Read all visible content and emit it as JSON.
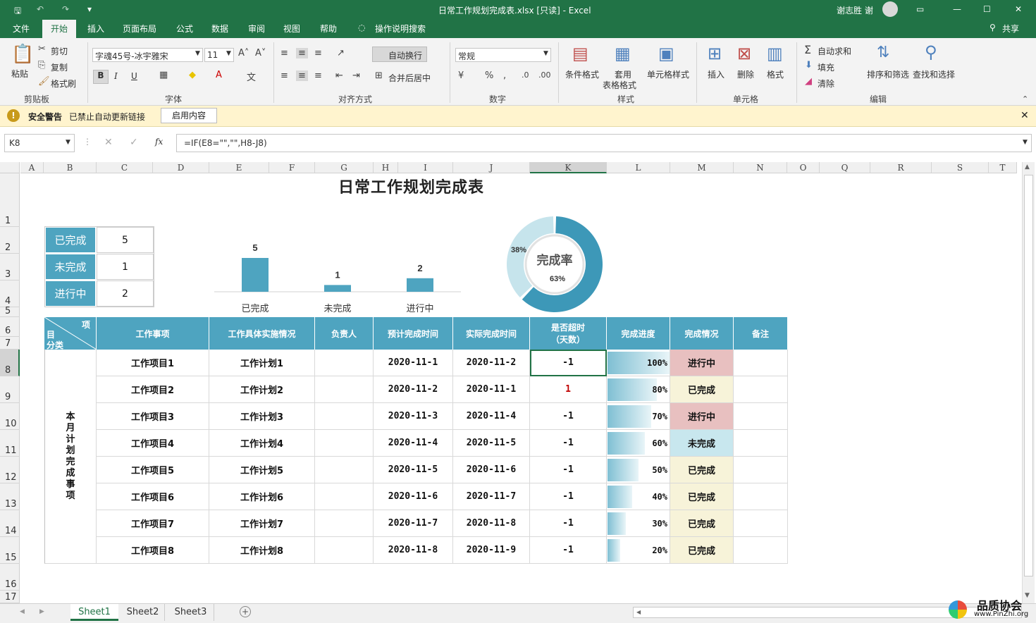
{
  "window": {
    "title": "日常工作规划完成表.xlsx  [只读]  -  Excel",
    "user": "谢志胜 谢"
  },
  "menu": [
    "文件",
    "开始",
    "插入",
    "页面布局",
    "公式",
    "数据",
    "审阅",
    "视图",
    "帮助",
    "操作说明搜索"
  ],
  "share": "共享",
  "ribbon": {
    "paste": "粘贴",
    "cut": "剪切",
    "copy": "复制",
    "format_painter": "格式刷",
    "clipboard": "剪贴板",
    "font_name": "字魂45号-冰宇雅宋",
    "font_size": "11",
    "font_group": "字体",
    "bold": "B",
    "italic": "I",
    "underline": "U",
    "wrap": "自动换行",
    "merge": "合并后居中",
    "align_group": "对齐方式",
    "num_format": "常规",
    "number_group": "数字",
    "cond_format": "条件格式",
    "table_format_1": "套用",
    "table_format_2": "表格格式",
    "cell_style": "单元格样式",
    "style_group": "样式",
    "insert": "插入",
    "delete": "删除",
    "format": "格式",
    "cells_group": "单元格",
    "autosum": "自动求和",
    "fill": "填充",
    "clear": "清除",
    "sort": "排序和筛选",
    "find": "查找和选择",
    "edit_group": "编辑"
  },
  "warning": {
    "label": "安全警告",
    "text": "已禁止自动更新链接",
    "button": "启用内容"
  },
  "formula": {
    "namebox": "K8",
    "content": "=IF(E8=\"\",\"\",H8-J8)",
    "fx": "fx"
  },
  "columns": [
    "A",
    "B",
    "C",
    "D",
    "E",
    "F",
    "G",
    "H",
    "I",
    "J",
    "K",
    "L",
    "M",
    "N",
    "O",
    "Q",
    "R",
    "S",
    "T"
  ],
  "rows": [
    "1",
    "2",
    "3",
    "4",
    "5",
    "6",
    "7",
    "8",
    "9",
    "10",
    "11",
    "12",
    "13",
    "14",
    "15",
    "16",
    "17"
  ],
  "sheet": {
    "title": "日常工作规划完成表",
    "stats": [
      {
        "label": "已完成",
        "value": "5"
      },
      {
        "label": "未完成",
        "value": "1"
      },
      {
        "label": "进行中",
        "value": "2"
      }
    ],
    "table_headers": {
      "corner_top": "项",
      "corner_mid": "目",
      "corner_bottom": "分类",
      "c1": "工作事项",
      "c2": "工作具体实施情况",
      "c3": "负责人",
      "c4": "预计完成时间",
      "c5": "实际完成时间",
      "c6a": "是否超时",
      "c6b": "（天数）",
      "c7": "完成进度",
      "c8": "完成情况",
      "c9": "备注"
    },
    "category": "本月计划完成事项",
    "rows": [
      {
        "item": "工作项目1",
        "plan": "工作计划1",
        "owner": "",
        "expected": "2020-11-1",
        "actual": "2020-11-2",
        "overdue": "-1",
        "progress": 1.0,
        "progress_label": "100%",
        "status": "进行中"
      },
      {
        "item": "工作项目2",
        "plan": "工作计划2",
        "owner": "",
        "expected": "2020-11-2",
        "actual": "2020-11-1",
        "overdue": "1",
        "progress": 0.8,
        "progress_label": "80%",
        "status": "已完成"
      },
      {
        "item": "工作项目3",
        "plan": "工作计划3",
        "owner": "",
        "expected": "2020-11-3",
        "actual": "2020-11-4",
        "overdue": "-1",
        "progress": 0.7,
        "progress_label": "70%",
        "status": "进行中"
      },
      {
        "item": "工作项目4",
        "plan": "工作计划4",
        "owner": "",
        "expected": "2020-11-4",
        "actual": "2020-11-5",
        "overdue": "-1",
        "progress": 0.6,
        "progress_label": "60%",
        "status": "未完成"
      },
      {
        "item": "工作项目5",
        "plan": "工作计划5",
        "owner": "",
        "expected": "2020-11-5",
        "actual": "2020-11-6",
        "overdue": "-1",
        "progress": 0.5,
        "progress_label": "50%",
        "status": "已完成"
      },
      {
        "item": "工作项目6",
        "plan": "工作计划6",
        "owner": "",
        "expected": "2020-11-6",
        "actual": "2020-11-7",
        "overdue": "-1",
        "progress": 0.4,
        "progress_label": "40%",
        "status": "已完成"
      },
      {
        "item": "工作项目7",
        "plan": "工作计划7",
        "owner": "",
        "expected": "2020-11-7",
        "actual": "2020-11-8",
        "overdue": "-1",
        "progress": 0.3,
        "progress_label": "30%",
        "status": "已完成"
      },
      {
        "item": "工作项目8",
        "plan": "工作计划8",
        "owner": "",
        "expected": "2020-11-8",
        "actual": "2020-11-9",
        "overdue": "-1",
        "progress": 0.2,
        "progress_label": "20%",
        "status": "已完成"
      }
    ],
    "status_colors": {
      "进行中": "#e8c0c0",
      "已完成": "#f7f3d9",
      "未完成": "#c8e7ee"
    }
  },
  "chart_data": [
    {
      "type": "bar",
      "categories": [
        "已完成",
        "未完成",
        "进行中"
      ],
      "values": [
        5,
        1,
        2
      ],
      "ylim": [
        0,
        5
      ]
    },
    {
      "type": "pie",
      "center_label": "完成率",
      "slices": [
        {
          "label": "63%",
          "value": 63
        },
        {
          "label": "38%",
          "value": 38
        }
      ]
    }
  ],
  "colors": {
    "accent": "#217346",
    "header": "#4ea4c0",
    "donut_main": "#3d98b8",
    "donut_rest": "#c6e4ec"
  },
  "sheets": [
    "Sheet1",
    "Sheet2",
    "Sheet3"
  ],
  "watermark": {
    "brand": "品质协会",
    "url": "www.PinZhi.org"
  }
}
